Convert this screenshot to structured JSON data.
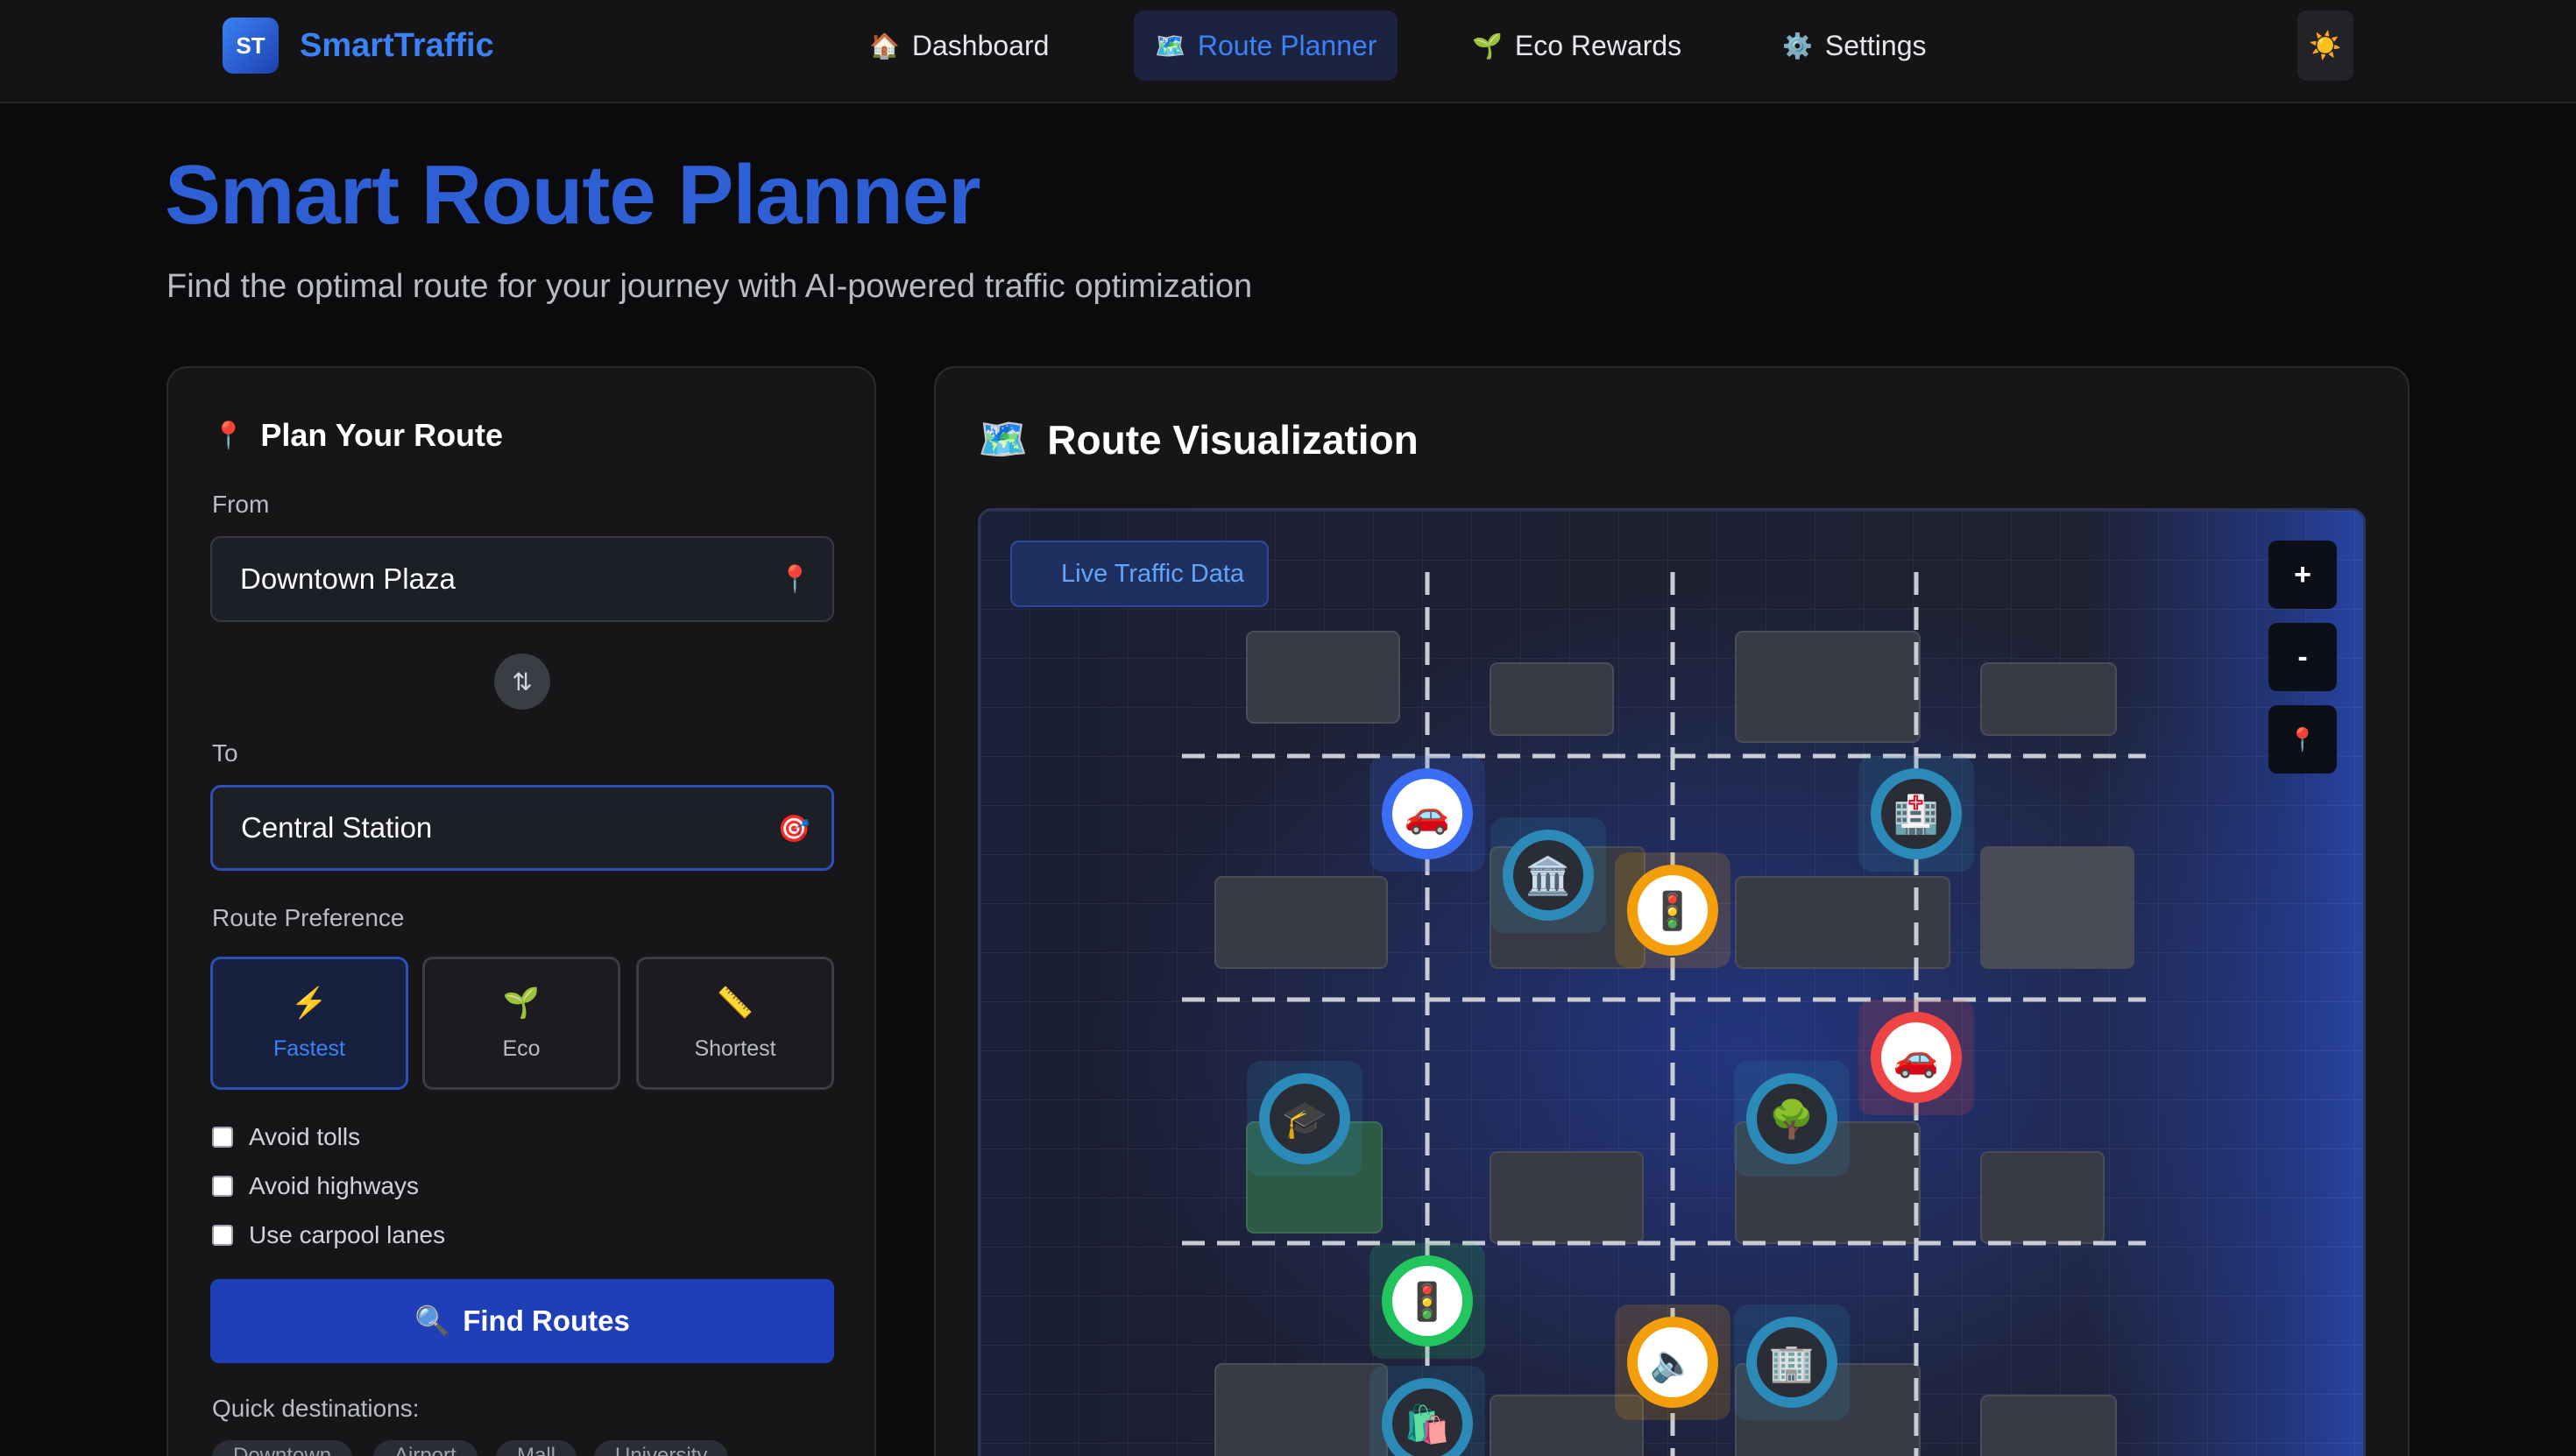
{
  "brand": {
    "badge": "ST",
    "name": "SmartTraffic"
  },
  "nav": [
    {
      "icon": "🏠",
      "label": "Dashboard"
    },
    {
      "icon": "🗺️",
      "label": "Route Planner",
      "active": true
    },
    {
      "icon": "🌱",
      "label": "Eco Rewards"
    },
    {
      "icon": "⚙️",
      "label": "Settings"
    }
  ],
  "theme_toggle_icon": "☀️",
  "header": {
    "title": "Smart Route Planner",
    "subtitle": "Find the optimal route for your journey with AI-powered traffic optimization"
  },
  "plan": {
    "title": "Plan Your Route",
    "title_icon": "📍",
    "from_label": "From",
    "from_value": "Downtown Plaza",
    "from_icon": "📍",
    "swap_icon": "⇅",
    "to_label": "To",
    "to_value": "Central Station",
    "to_icon": "🎯",
    "pref_label": "Route Preference",
    "prefs": [
      {
        "icon": "⚡",
        "label": "Fastest",
        "active": true
      },
      {
        "icon": "🌱",
        "label": "Eco"
      },
      {
        "icon": "📏",
        "label": "Shortest"
      }
    ],
    "options": [
      "Avoid tolls",
      "Avoid highways",
      "Use carpool lanes"
    ],
    "find_icon": "🔍",
    "find_label": "Find Routes",
    "quick_label": "Quick destinations:",
    "quick_chips": [
      "Downtown",
      "Airport",
      "Mall",
      "University"
    ]
  },
  "viz": {
    "title": "Route Visualization",
    "title_icon": "🗺️",
    "live_label": "Live Traffic Data",
    "controls": [
      "+",
      "-",
      "📍"
    ],
    "markers": [
      {
        "name": "car-start-marker",
        "icon": "🚗",
        "ring": "#3b6ef5"
      },
      {
        "name": "museum-marker",
        "icon": "🏛️",
        "ring": "#2b8ab8"
      },
      {
        "name": "traffic-light-marker",
        "icon": "🚦",
        "ring": "#f59e0b"
      },
      {
        "name": "hospital-marker",
        "icon": "🏥",
        "ring": "#2b8ab8"
      },
      {
        "name": "car-destination-marker",
        "icon": "🚗",
        "ring": "#ef4444"
      },
      {
        "name": "university-marker",
        "icon": "🎓",
        "ring": "#2b8ab8"
      },
      {
        "name": "park-marker",
        "icon": "🌳",
        "ring": "#2b8ab8"
      },
      {
        "name": "traffic-light-marker",
        "icon": "🚦",
        "ring": "#22c55e"
      },
      {
        "name": "speaker-marker",
        "icon": "🔈",
        "ring": "#f59e0b"
      },
      {
        "name": "office-marker",
        "icon": "🏢",
        "ring": "#2b8ab8"
      },
      {
        "name": "shopping-marker",
        "icon": "🛍️",
        "ring": "#2b8ab8"
      }
    ]
  },
  "colors": {
    "accent": "#3b82f6",
    "primary_button": "#1f3fb8",
    "background": "#0b0b0d"
  }
}
